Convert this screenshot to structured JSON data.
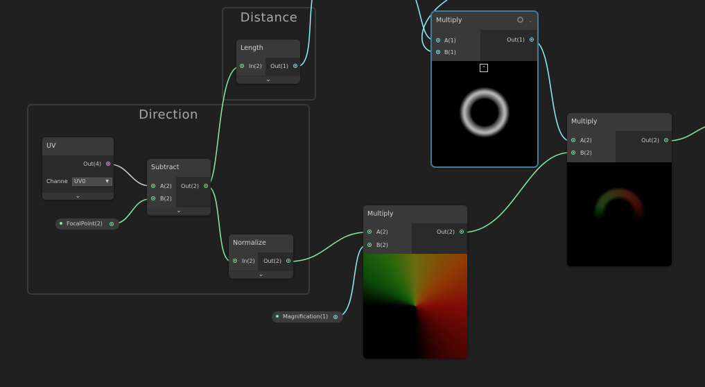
{
  "groups": {
    "distance": "Distance",
    "direction": "Direction"
  },
  "nodes": {
    "length": {
      "title": "Length",
      "input": "In(2)",
      "output": "Out(1)"
    },
    "uv": {
      "title": "UV",
      "output": "Out(4)",
      "channel_label": "Channe",
      "channel_value": "UV0"
    },
    "subtract": {
      "title": "Subtract",
      "input_a": "A(2)",
      "input_b": "B(2)",
      "output": "Out(2)"
    },
    "normalize": {
      "title": "Normalize",
      "input": "In(2)",
      "output": "Out(2)"
    },
    "multiply_top": {
      "title": "Multiply",
      "input_a": "A(1)",
      "input_b": "B(1)",
      "output": "Out(1)"
    },
    "multiply_right": {
      "title": "Multiply",
      "input_a": "A(2)",
      "input_b": "B(2)",
      "output": "Out(2)"
    },
    "multiply_mid": {
      "title": "Multiply",
      "input_a": "A(2)",
      "input_b": "B(2)",
      "output": "Out(2)"
    }
  },
  "properties": {
    "focal_point": "FocalPoint(2)",
    "magnification": "Magnification(1)"
  },
  "icons": {
    "expand": "chevron-down-icon",
    "collapse": "chevron-up-icon",
    "settings": "gear-icon"
  },
  "colors": {
    "vec2_port": "#84e4a2",
    "float_port": "#8ae7f0",
    "vec4_port": "#f0a0e0",
    "selection": "#3f7e9e",
    "background": "#202020"
  }
}
